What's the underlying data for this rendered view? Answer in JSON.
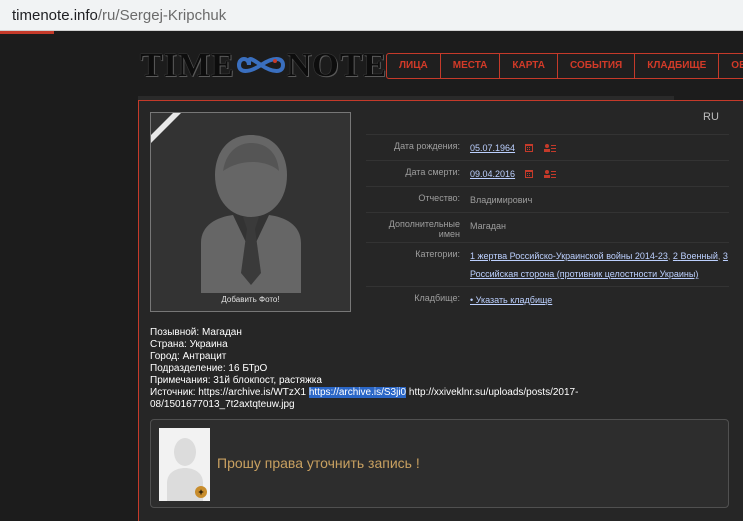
{
  "browser": {
    "host": "timenote.info",
    "path": "/ru/Sergej-Kripchuk"
  },
  "logo": {
    "left": "TIME",
    "right": "NOTE"
  },
  "nav": [
    "ЛИЦА",
    "МЕСТА",
    "КАРТА",
    "СОБЫТИЯ",
    "КЛАДБИЩЕ",
    "ОБ"
  ],
  "lang": "RU",
  "photo": {
    "label": "Добавить Фото!"
  },
  "info": {
    "birth_label": "Дата рождения:",
    "birth_value": "05.07.1964",
    "death_label": "Дата смерти:",
    "death_value": "09.04.2016",
    "patronymic_label": "Отчество:",
    "patronymic_value": "Владимирович",
    "extra_label": "Дополнительные имен",
    "extra_value": "Магадан",
    "categories_label": "Категории:",
    "categories": [
      {
        "num": "1",
        "text": "жертва Российско-Украинской войны 2014-23",
        "sep": ", "
      },
      {
        "num": "2",
        "text": "Военный",
        "sep": ", "
      },
      {
        "num": "3",
        "text": "Российская сторона (противник целостности Украины)",
        "sep": ""
      }
    ],
    "cemetery_label": "Кладбище:",
    "cemetery_value": "• Указать кладбище"
  },
  "details": {
    "line1": "Позывной: Магадан",
    "line2": "Страна: Украина",
    "line3": "Город: Антрацит",
    "line4": "Подразделение: 16 БТрО",
    "line5": "Примечания: 31й блокпост, растяжка",
    "source_prefix": "Источник: https://archive.is/WTzX1 ",
    "source_highlight": "https://archive.is/S3ji0",
    "source_suffix": " http://xxiveklnr.su/uploads/posts/2017-08/1501677013_7t2axtqteuw.jpg"
  },
  "notice": {
    "text": "Прошу права уточнить запись !",
    "plus": "+"
  },
  "colors": {
    "accent": "#c53a2a",
    "background": "#1c1c1c",
    "panel": "#262626",
    "notice_text": "#c8a060"
  }
}
